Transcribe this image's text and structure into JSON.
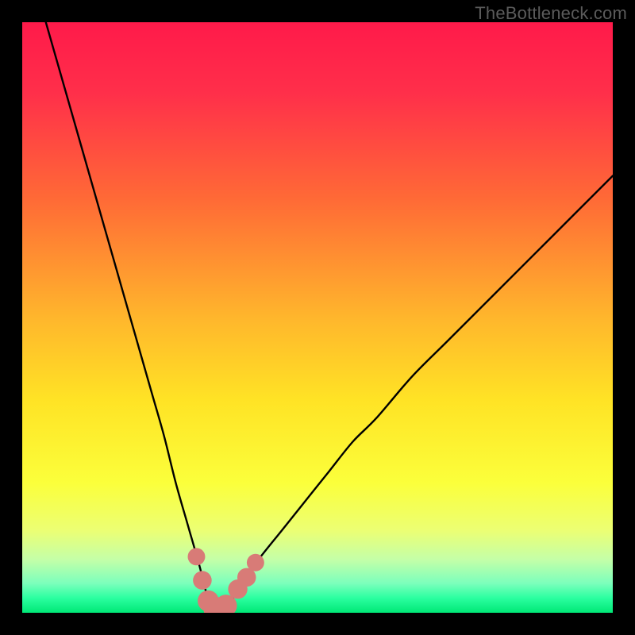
{
  "watermark": "TheBottleneck.com",
  "chart_data": {
    "type": "line",
    "title": "",
    "xlabel": "",
    "ylabel": "",
    "xlim": [
      0,
      100
    ],
    "ylim": [
      0,
      100
    ],
    "note": "Axes unlabeled; x roughly represents a component rating, y the bottleneck percentage. Values are estimated from pixel positions.",
    "gradient_stops": [
      {
        "pos": 0.0,
        "color": "#ff1a4a"
      },
      {
        "pos": 0.12,
        "color": "#ff2f4a"
      },
      {
        "pos": 0.3,
        "color": "#ff6a36"
      },
      {
        "pos": 0.5,
        "color": "#ffb62c"
      },
      {
        "pos": 0.64,
        "color": "#ffe325"
      },
      {
        "pos": 0.78,
        "color": "#fbff3b"
      },
      {
        "pos": 0.86,
        "color": "#ecff73"
      },
      {
        "pos": 0.91,
        "color": "#c4ffa8"
      },
      {
        "pos": 0.95,
        "color": "#7cffbc"
      },
      {
        "pos": 0.975,
        "color": "#2bffa0"
      },
      {
        "pos": 1.0,
        "color": "#00e876"
      }
    ],
    "series": [
      {
        "name": "bottleneck-curve",
        "x": [
          4,
          6,
          8,
          10,
          12,
          14,
          16,
          18,
          20,
          22,
          24,
          26,
          28,
          30,
          31,
          32,
          33,
          34,
          35,
          36,
          38,
          40,
          44,
          48,
          52,
          56,
          60,
          66,
          72,
          80,
          90,
          100
        ],
        "y": [
          100,
          93,
          86,
          79,
          72,
          65,
          58,
          51,
          44,
          37,
          30,
          22,
          15,
          8,
          4,
          1,
          0,
          0,
          1,
          3,
          6,
          9,
          14,
          19,
          24,
          29,
          33,
          40,
          46,
          54,
          64,
          74
        ]
      }
    ],
    "highlight_points": {
      "note": "Salmon-colored markers near the curve minimum",
      "color": "#d87b77",
      "points": [
        {
          "x": 29.5,
          "y": 9.5,
          "r": 1.7
        },
        {
          "x": 30.5,
          "y": 5.5,
          "r": 1.9
        },
        {
          "x": 31.5,
          "y": 2.0,
          "r": 2.3
        },
        {
          "x": 32.5,
          "y": 0.8,
          "r": 2.4
        },
        {
          "x": 33.5,
          "y": 0.8,
          "r": 2.4
        },
        {
          "x": 34.5,
          "y": 1.2,
          "r": 2.4
        },
        {
          "x": 36.5,
          "y": 4.0,
          "r": 2.0
        },
        {
          "x": 38.0,
          "y": 6.0,
          "r": 1.9
        },
        {
          "x": 39.5,
          "y": 8.5,
          "r": 1.7
        }
      ]
    }
  }
}
